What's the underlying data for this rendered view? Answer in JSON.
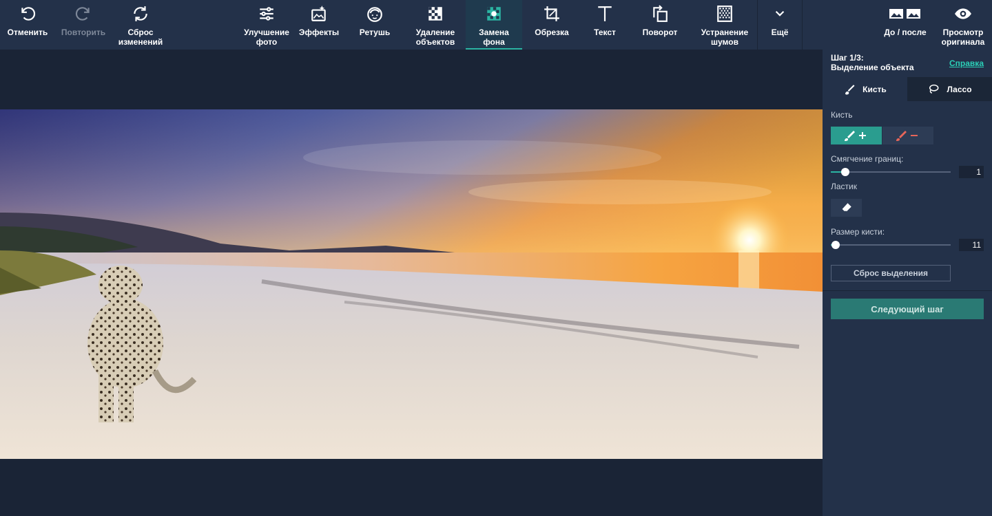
{
  "toolbar": {
    "undo": "Отменить",
    "redo": "Повторить",
    "reset_line1": "Сброс",
    "reset_line2": "изменений",
    "enhance_line1": "Улучшение",
    "enhance_line2": "фото",
    "effects": "Эффекты",
    "retouch": "Ретушь",
    "remove_line1": "Удаление",
    "remove_line2": "объектов",
    "replace_bg_line1": "Замена",
    "replace_bg_line2": "фона",
    "crop": "Обрезка",
    "text": "Текст",
    "rotate": "Поворот",
    "denoise_line1": "Устранение",
    "denoise_line2": "шумов",
    "more": "Ещё",
    "before_after": "До / после",
    "preview_line1": "Просмотр",
    "preview_line2": "оригинала"
  },
  "panel": {
    "step_line1": "Шаг 1/3:",
    "step_line2": "Выделение объекта",
    "help": "Справка",
    "tab_brush": "Кисть",
    "tab_lasso": "Лассо",
    "brush_label": "Кисть",
    "feather_label": "Смягчение границ:",
    "feather_value": "1",
    "feather_level": 0.12,
    "eraser_label": "Ластик",
    "brush_size_label": "Размер кисти:",
    "brush_size_value": "11",
    "brush_size_level": 0.04,
    "reset_selection": "Сброс выделения",
    "next_step": "Следующий шаг"
  },
  "colors": {
    "accent": "#2bb5a3",
    "toolbar_bg": "#233149",
    "canvas_bg": "#1a2436",
    "brush_add": "#2a9d8f",
    "brush_remove_icon": "#e8665a"
  },
  "icons": [
    "undo-icon",
    "redo-icon",
    "reset-icon",
    "enhance-icon",
    "effects-icon",
    "retouch-icon",
    "remove-objects-icon",
    "replace-background-icon",
    "crop-icon",
    "text-icon",
    "rotate-icon",
    "denoise-icon",
    "chevron-down-icon",
    "before-after-icon",
    "eye-icon",
    "brush-icon",
    "lasso-icon",
    "brush-add-icon",
    "brush-remove-icon",
    "eraser-icon"
  ]
}
